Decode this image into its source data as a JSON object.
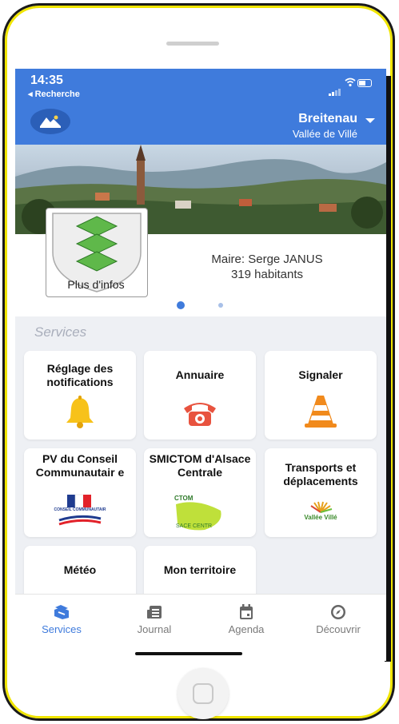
{
  "status": {
    "time": "14:35",
    "back_label": "◂ Recherche"
  },
  "header": {
    "commune": "Breitenau",
    "vallee": "Vallée de Villé",
    "accent": "#3f7bdc"
  },
  "commune_card": {
    "plus_infos": "Plus d'infos",
    "maire": "Maire: Serge JANUS",
    "habitants": "319 habitants"
  },
  "section": {
    "title": "Services"
  },
  "tiles": [
    {
      "label": "Réglage des notifications",
      "icon": "bell-icon"
    },
    {
      "label": "Annuaire",
      "icon": "phone-icon"
    },
    {
      "label": "Signaler",
      "icon": "traffic-cone-icon"
    },
    {
      "label": "PV du Conseil Communautair e",
      "icon": "conseil-logo",
      "logo_text": "CONSEIL COMMUNAUTAIR"
    },
    {
      "label": "SMICTOM d'Alsace Centrale",
      "icon": "smictom-logo",
      "logo_text_top": "CTOM",
      "logo_text_bottom": "SACE CENTR"
    },
    {
      "label": "Transports et déplacements",
      "icon": "vallee-ville-logo",
      "logo_text": "Vallée Villé"
    },
    {
      "label": "Météo",
      "icon": "weather-icon"
    },
    {
      "label": "Mon territoire",
      "icon": "map-icon"
    }
  ],
  "tabs": [
    {
      "label": "Services",
      "icon": "services-icon",
      "active": true
    },
    {
      "label": "Journal",
      "icon": "journal-icon",
      "active": false
    },
    {
      "label": "Agenda",
      "icon": "calendar-icon",
      "active": false
    },
    {
      "label": "Découvrir",
      "icon": "compass-icon",
      "active": false
    }
  ]
}
